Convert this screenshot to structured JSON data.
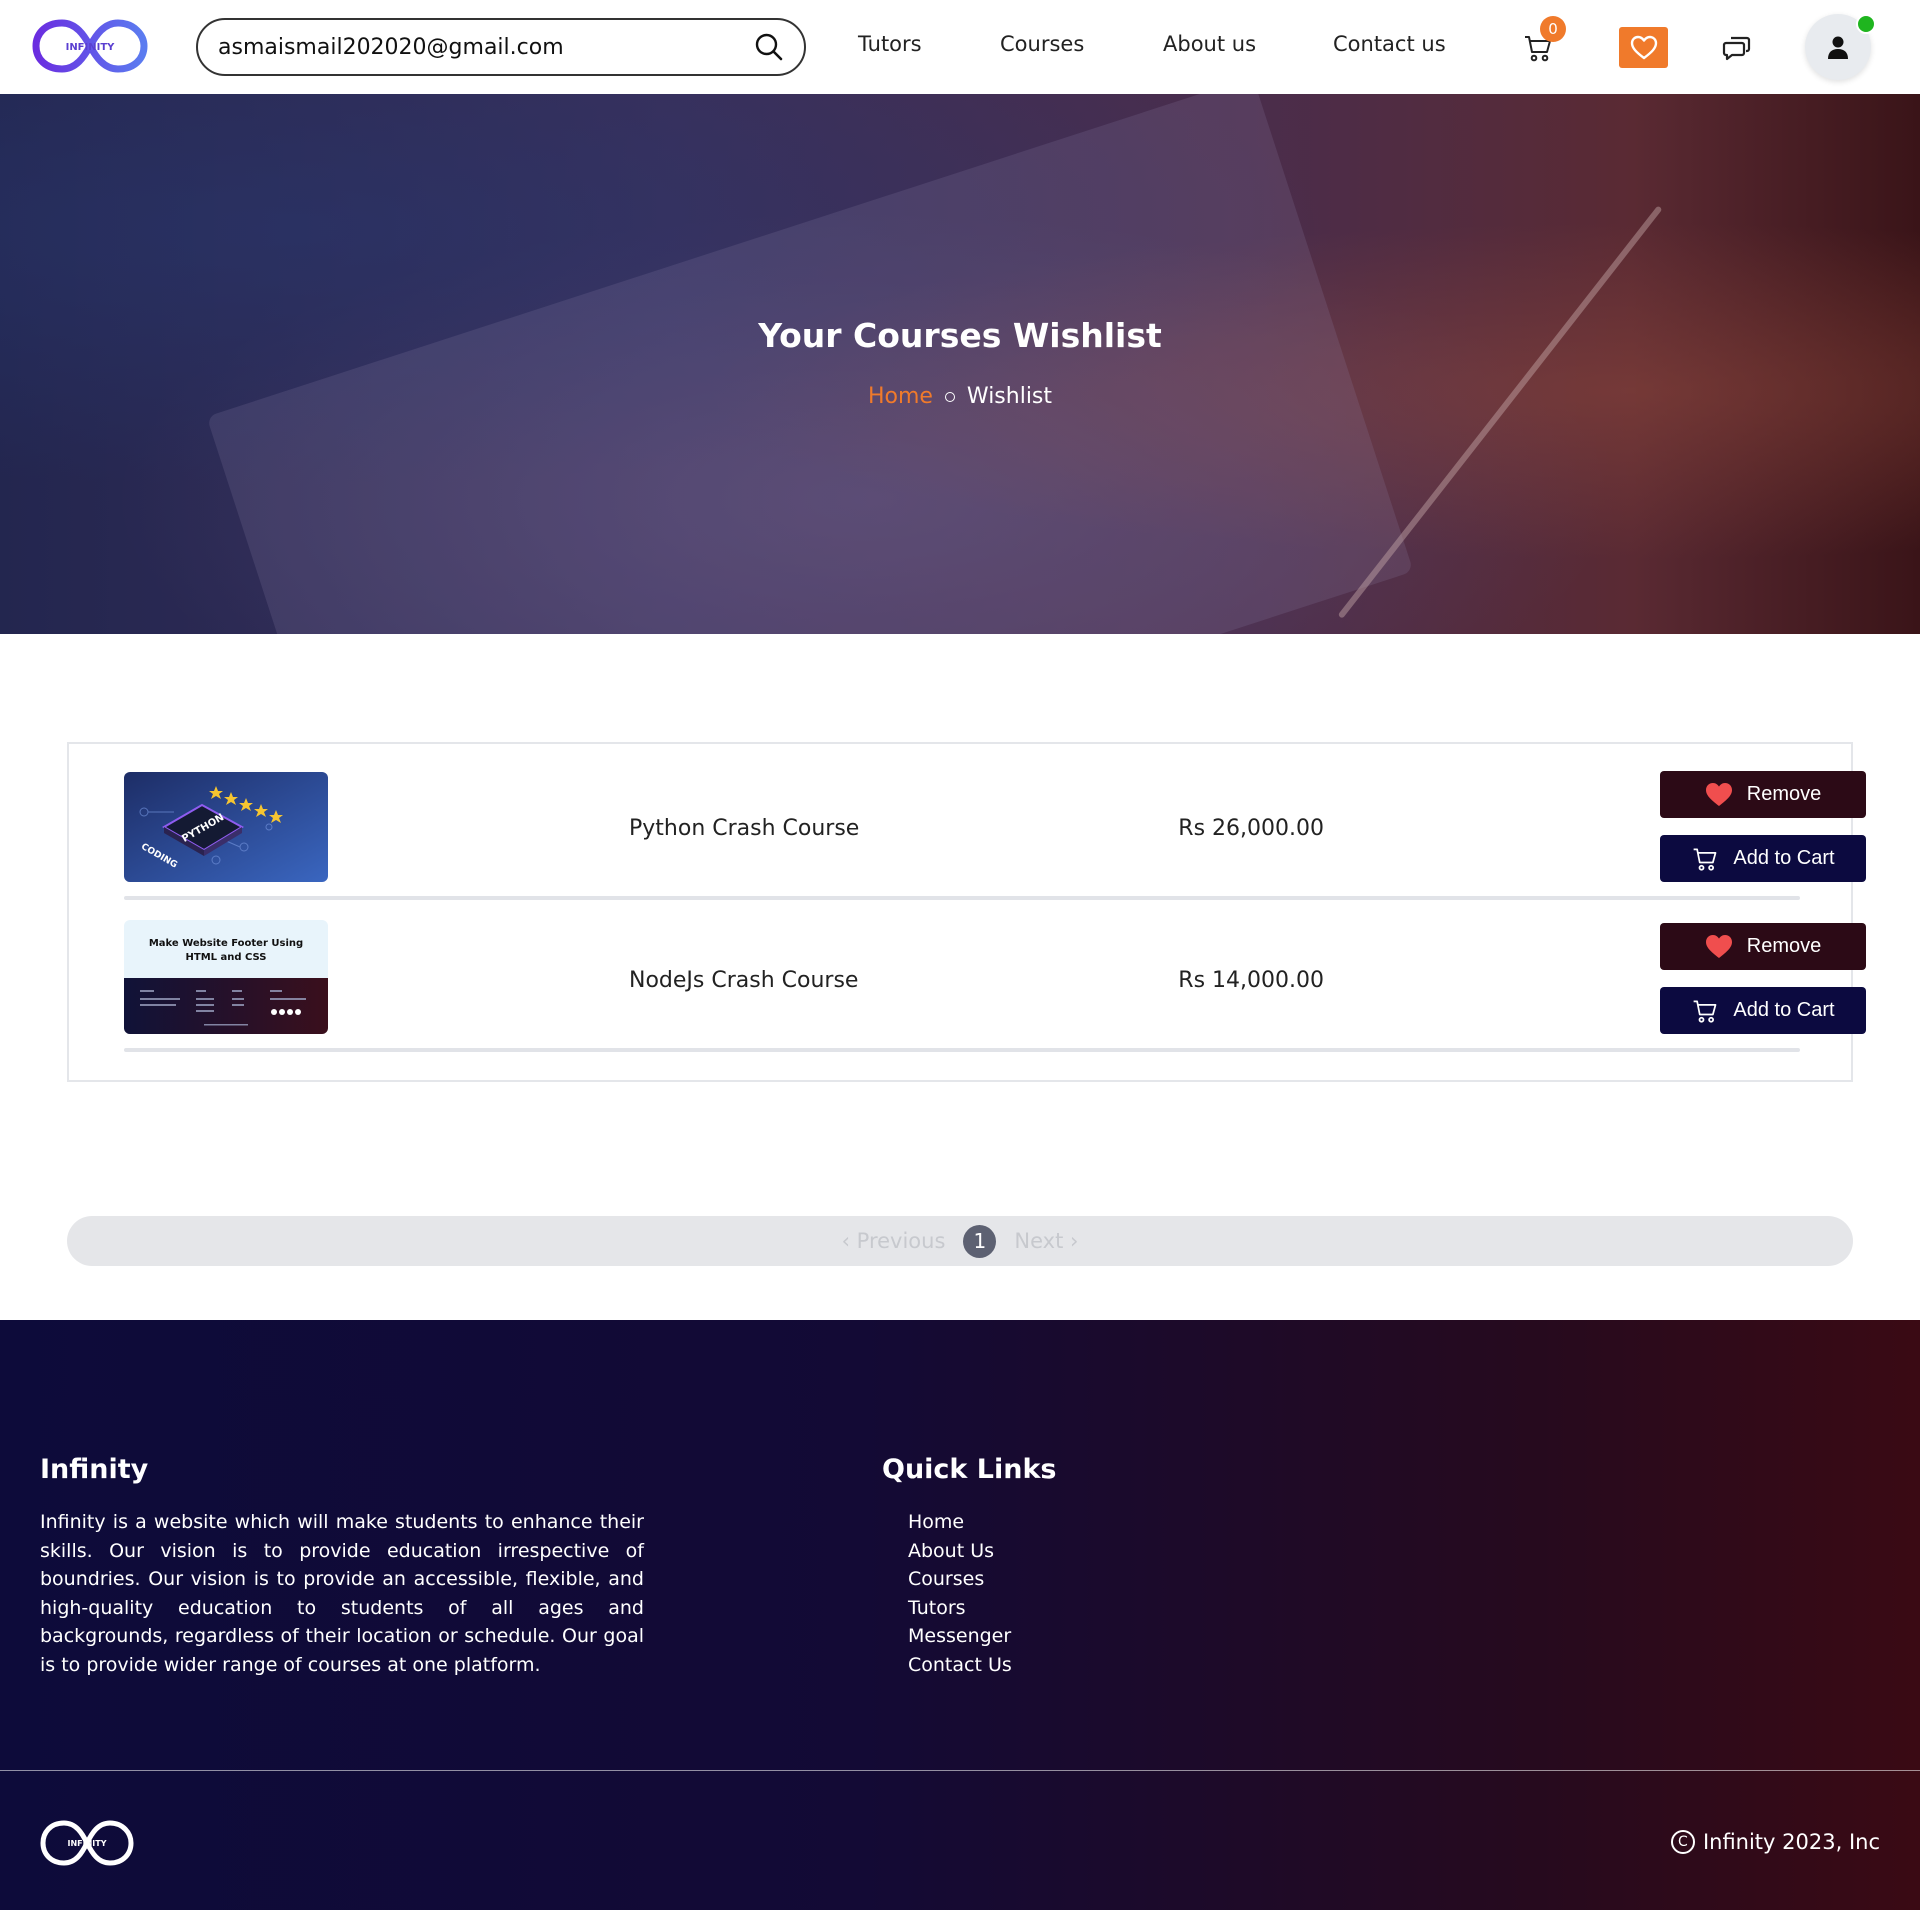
{
  "header": {
    "logo_text": "INFINITY",
    "search": {
      "value": "asmaismail202020@gmail.com"
    },
    "nav": [
      "Tutors",
      "Courses",
      "About us",
      "Contact us"
    ],
    "cart_count": "0",
    "accent": "#f07a2b"
  },
  "hero": {
    "title": "Your Courses Wishlist",
    "breadcrumb": {
      "home": "Home",
      "current": "Wishlist"
    }
  },
  "wishlist": {
    "items": [
      {
        "name": "Python Crash Course",
        "price": "Rs 26,000.00",
        "thumb": {
          "badge": "PYTHON",
          "caption": "CODING"
        },
        "remove_label": "Remove",
        "cart_label": "Add to Cart"
      },
      {
        "name": "NodeJs Crash Course",
        "price": "Rs 14,000.00",
        "thumb": {
          "line1": "Make Website Footer Using",
          "line2": "HTML and CSS"
        },
        "remove_label": "Remove",
        "cart_label": "Add to Cart"
      }
    ]
  },
  "pagination": {
    "prev": "‹ Previous",
    "page": "1",
    "next": "Next ›"
  },
  "footer": {
    "brand_title": "Infinity",
    "description": "Infinity is a website which will make students to enhance their skills. Our vision is to provide education irrespective of boundries. Our vision is to provide an accessible, flexible, and high-quality education to students of all ages and backgrounds, regardless of their location or schedule. Our goal is to provide wider range of courses at one platform.",
    "links_title": "Quick Links",
    "links": [
      "Home",
      "About Us",
      "Courses",
      "Tutors",
      "Messenger",
      "Contact Us"
    ],
    "logo_text": "INFINITY",
    "copyright": "Infinity 2023, Inc"
  }
}
